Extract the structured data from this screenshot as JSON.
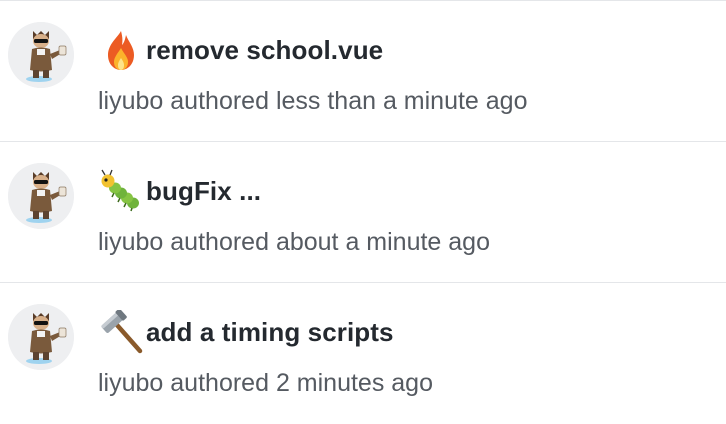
{
  "commits": [
    {
      "icon": "fire-icon",
      "message": "remove school.vue",
      "author": "liyubo",
      "action": "authored",
      "time": "less than a minute ago"
    },
    {
      "icon": "bug-icon",
      "message": "bugFix ...",
      "author": "liyubo",
      "action": "authored",
      "time": "about a minute ago"
    },
    {
      "icon": "hammer-icon",
      "message": "add a timing scripts",
      "author": "liyubo",
      "action": "authored",
      "time": "2 minutes ago"
    }
  ]
}
